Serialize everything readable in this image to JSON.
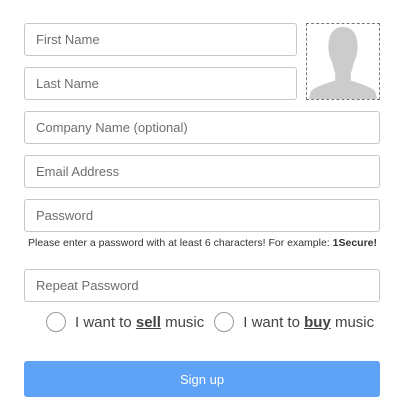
{
  "form": {
    "first_name": {
      "placeholder": "First Name",
      "value": ""
    },
    "last_name": {
      "placeholder": "Last Name",
      "value": ""
    },
    "company_name": {
      "placeholder": "Company Name (optional)",
      "value": ""
    },
    "email": {
      "placeholder": "Email Address",
      "value": ""
    },
    "password": {
      "placeholder": "Password",
      "value": ""
    },
    "password_hint_text": "Please enter a password with at least 6 characters! For example: ",
    "password_hint_example": "1Secure!",
    "repeat_password": {
      "placeholder": "Repeat Password",
      "value": ""
    },
    "avatar_icon": "person-silhouette-icon"
  },
  "account_type": {
    "sell": {
      "prefix": "I want to ",
      "keyword": "sell",
      "suffix": " music",
      "selected": false
    },
    "buy": {
      "prefix": "I want to ",
      "keyword": "buy",
      "suffix": " music",
      "selected": false
    }
  },
  "signup_button": {
    "label": "Sign up"
  },
  "colors": {
    "button_bg": "#5ea3f6",
    "field_border": "#c8c8c8",
    "avatar_silhouette": "#cccccc"
  }
}
